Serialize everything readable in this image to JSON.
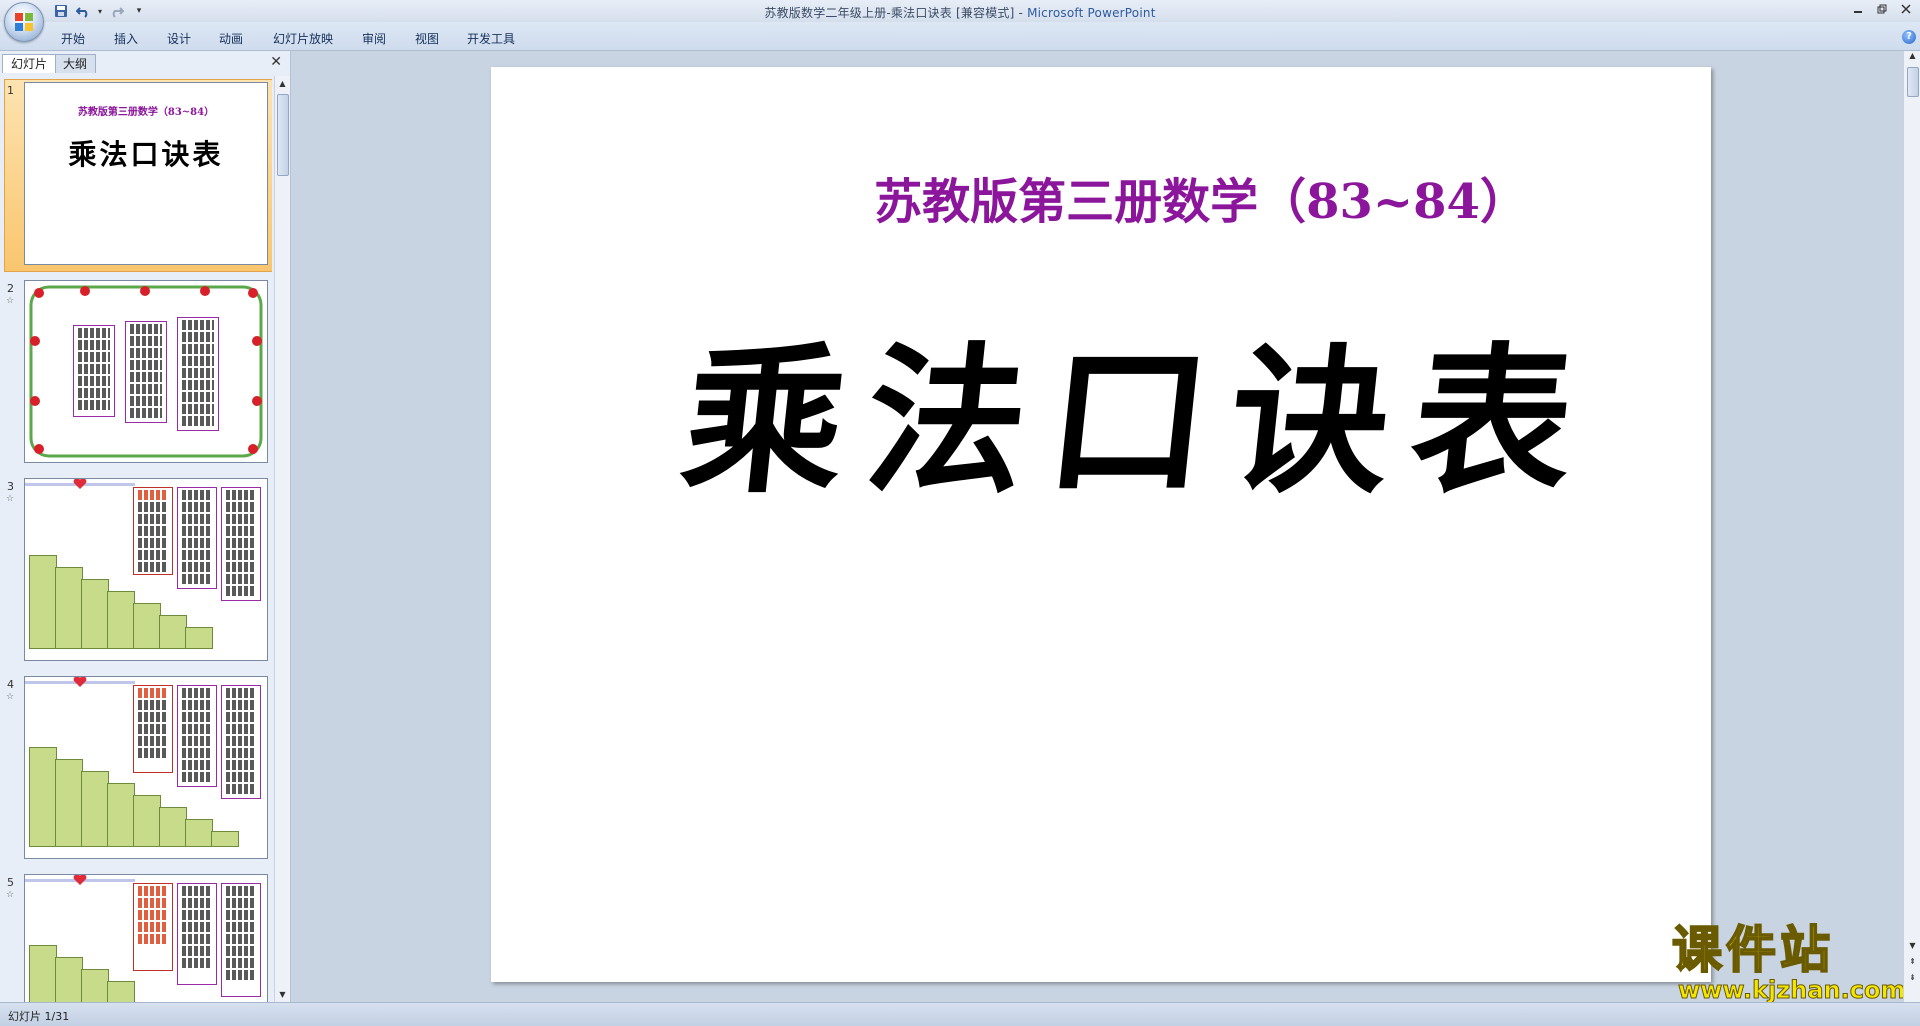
{
  "window": {
    "document_title": "苏教版数学二年级上册-乘法口诀表 [兼容模式]",
    "separator": " - ",
    "app_name": "Microsoft PowerPoint"
  },
  "ribbon": {
    "tabs": [
      "开始",
      "插入",
      "设计",
      "动画",
      "幻灯片放映",
      "审阅",
      "视图",
      "开发工具"
    ]
  },
  "left_panel": {
    "tab_slides": "幻灯片",
    "tab_outline": "大纲",
    "thumbnails": [
      {
        "number": "1",
        "subtitle": "苏教版第三册数学（83~84）",
        "title": "乘法口诀表"
      },
      {
        "number": "2"
      },
      {
        "number": "3"
      },
      {
        "number": "4"
      },
      {
        "number": "5"
      }
    ]
  },
  "slide": {
    "subtitle": "苏教版第三册数学（83~84）",
    "title": "乘法口诀表"
  },
  "watermark": {
    "text": "课件站",
    "url": "www.kjzhan.com"
  },
  "status_bar": {
    "slide_info": "幻灯片 1/31"
  },
  "colors": {
    "subtitle": "#8b169b",
    "selection": "#f9c66e",
    "watermark": "#f4e600"
  }
}
